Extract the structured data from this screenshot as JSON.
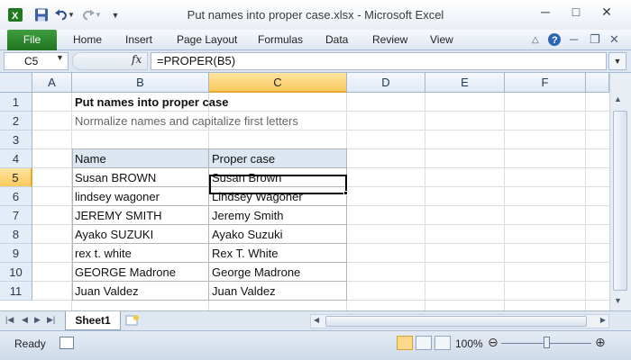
{
  "app": {
    "window_title": "Put names into proper case.xlsx  -  Microsoft Excel"
  },
  "ribbon": {
    "tabs": [
      "File",
      "Home",
      "Insert",
      "Page Layout",
      "Formulas",
      "Data",
      "Review",
      "View"
    ]
  },
  "formula_bar": {
    "name_box": "C5",
    "fx": "fx",
    "formula": "=PROPER(B5)"
  },
  "sheet": {
    "columns": [
      "A",
      "B",
      "C",
      "D",
      "E",
      "F"
    ],
    "rows": [
      "1",
      "2",
      "3",
      "4",
      "5",
      "6",
      "7",
      "8",
      "9",
      "10",
      "11"
    ],
    "active_column": "C",
    "active_row": "5",
    "title": "Put names into proper case",
    "subtitle": "Normalize names and capitalize first letters",
    "table_headers": [
      "Name",
      "Proper case"
    ],
    "table_rows": [
      [
        "Susan BROWN",
        "Susan Brown"
      ],
      [
        "lindsey wagoner",
        "Lindsey Wagoner"
      ],
      [
        "JEREMY SMITH",
        "Jeremy Smith"
      ],
      [
        "Ayako SUZUKI",
        "Ayako Suzuki"
      ],
      [
        "rex t. white",
        "Rex T. White"
      ],
      [
        "GEORGE Madrone",
        "George Madrone"
      ],
      [
        "Juan Valdez",
        "Juan Valdez"
      ]
    ]
  },
  "sheet_tabs": {
    "active": "Sheet1"
  },
  "status_bar": {
    "status": "Ready",
    "zoom": "100%"
  },
  "colors": {
    "file_tab": "#2a8a2a",
    "header_fill": "#dce6f1",
    "active_header": "#f9c95c"
  }
}
